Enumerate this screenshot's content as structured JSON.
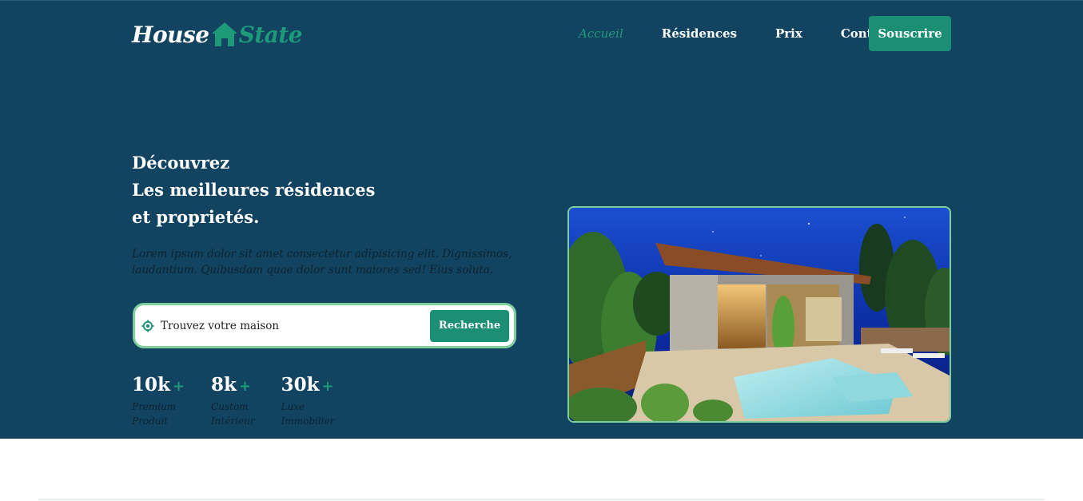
{
  "brand": {
    "part1": "House",
    "part2": "State",
    "icon": "house-icon"
  },
  "nav": {
    "links": [
      "Accueil",
      "Résidences",
      "Prix",
      "Contact"
    ],
    "active": "Accueil",
    "cta": "Souscrire"
  },
  "hero": {
    "title_lines": [
      "Découvrez",
      "Les meilleures résidences",
      "et proprietés."
    ],
    "description": "Lorem ipsum dolor sit amet consectetur adipisicing elit. Dignissimos, laudantium. Quibusdam quae dolor sunt maiores sed! Eius soluta.",
    "search": {
      "placeholder": "Trouvez votre maison",
      "button": "Recherche",
      "icon": "location-target-icon"
    },
    "stats": [
      {
        "value": "10k",
        "suffix": "+",
        "label_line1": "Premium",
        "label_line2": "Produit"
      },
      {
        "value": "8k",
        "suffix": "+",
        "label_line1": "Custom",
        "label_line2": "Intérieur"
      },
      {
        "value": "30k",
        "suffix": "+",
        "label_line1": "Luxe",
        "label_line2": "Immobilier"
      }
    ],
    "image": "modern-house-night-photo"
  },
  "colors": {
    "hero_bg": "#124461",
    "accent": "#1a8f74",
    "accent_light": "#7fcf9d",
    "text_dark": "#0b2230"
  }
}
